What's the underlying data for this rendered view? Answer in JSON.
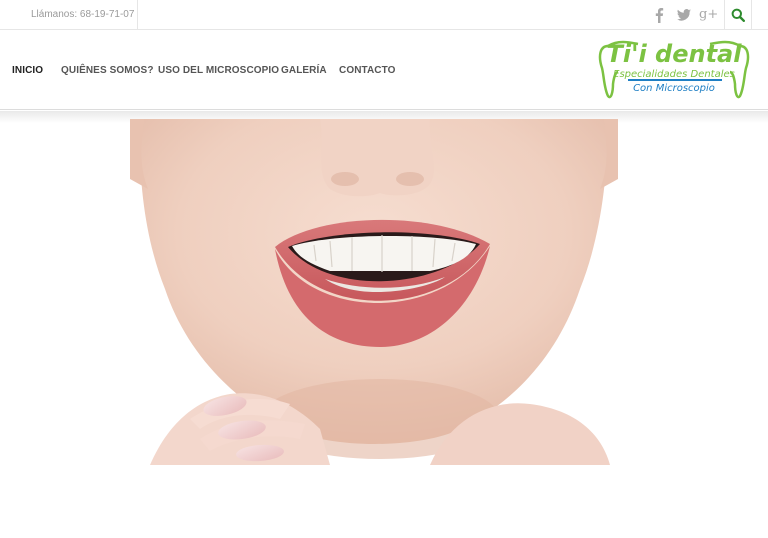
{
  "topbar": {
    "phone": "Llámanos: 68-19-71-07",
    "social": [
      {
        "icon": "facebook-icon",
        "glyph": "f"
      },
      {
        "icon": "twitter-icon",
        "glyph": "🐦"
      },
      {
        "icon": "google-plus-icon",
        "glyph": "g+"
      }
    ],
    "search_icon": "search-icon"
  },
  "nav": {
    "items": [
      {
        "label": "INICIO",
        "active": true
      },
      {
        "label": "QUIÊNES SOMOS?",
        "active": false
      },
      {
        "label": "USO DEL MICROSCOPIO",
        "active": false
      },
      {
        "label": "GALERÍA",
        "active": false
      },
      {
        "label": "CONTACTO",
        "active": false
      }
    ]
  },
  "logo": {
    "title": "Ti'i dental",
    "line1": "Especialidades Dentales",
    "line2": "Con Microscopio",
    "colors": {
      "green": "#7cc242",
      "blue": "#1f7fc4"
    }
  },
  "hero": {
    "image": "smiling-woman-teeth-photo"
  }
}
